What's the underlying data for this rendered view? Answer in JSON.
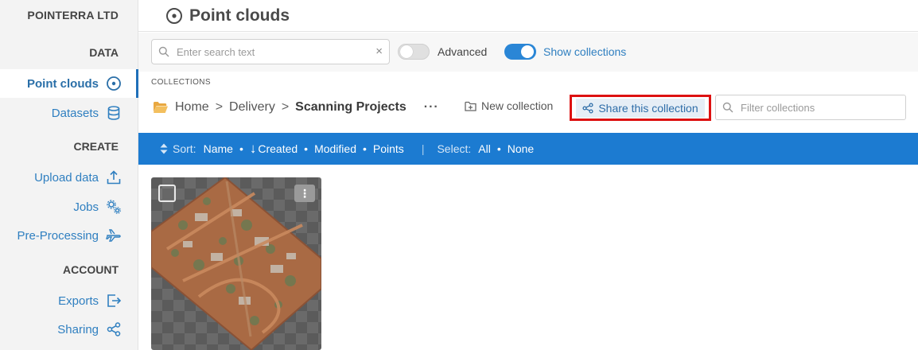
{
  "sidebar": {
    "org": "POINTERRA LTD",
    "sections": {
      "data": "DATA",
      "create": "CREATE",
      "account": "ACCOUNT"
    },
    "items": {
      "point_clouds": "Point clouds",
      "datasets": "Datasets",
      "upload": "Upload data",
      "jobs": "Jobs",
      "preprocessing": "Pre-Processing",
      "exports": "Exports",
      "sharing": "Sharing"
    }
  },
  "header": {
    "title": "Point clouds"
  },
  "toolbar": {
    "search_placeholder": "Enter search text",
    "clear": "×",
    "advanced_label": "Advanced",
    "advanced_on": false,
    "show_collections_label": "Show collections",
    "show_collections_on": true
  },
  "collections": {
    "caption": "COLLECTIONS",
    "breadcrumb": [
      "Home",
      "Delivery",
      "Scanning Projects"
    ],
    "more": "···",
    "new_collection": "New collection",
    "share": "Share this collection",
    "filter_placeholder": "Filter collections"
  },
  "sortbar": {
    "sort_label": "Sort:",
    "options": [
      "Name",
      "Created",
      "Modified",
      "Points"
    ],
    "active": "Created",
    "select_label": "Select:",
    "select_options": [
      "All",
      "None"
    ]
  },
  "card": {
    "menu": "⋮"
  },
  "colors": {
    "accent": "#1c7bd1",
    "highlight": "#dd1111",
    "link": "#2f7fc0"
  }
}
